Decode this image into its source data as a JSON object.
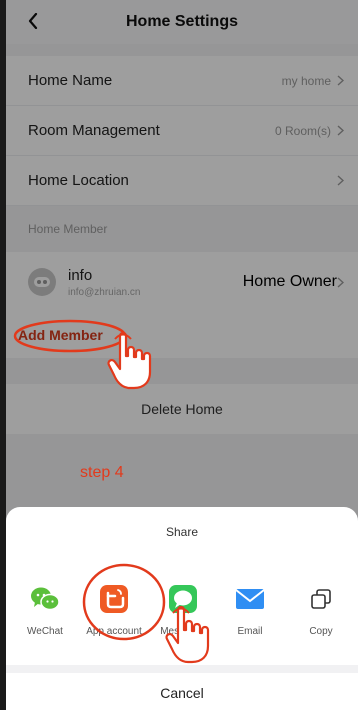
{
  "header": {
    "title": "Home Settings"
  },
  "settings": {
    "home_name": {
      "label": "Home Name",
      "value": "my home"
    },
    "room_management": {
      "label": "Room Management",
      "value": "0 Room(s)"
    },
    "home_location": {
      "label": "Home Location",
      "value": ""
    }
  },
  "member_section": {
    "label": "Home Member"
  },
  "member": {
    "name": "info",
    "email": "info@zhruian.cn",
    "role": "Home Owner"
  },
  "add_member": {
    "label": "Add Member"
  },
  "delete_home": {
    "label": "Delete Home"
  },
  "annotation": {
    "step": "step 4"
  },
  "share_sheet": {
    "title": "Share",
    "items": [
      {
        "label": "WeChat",
        "icon": "wechat-icon",
        "color": "#5bbf3b"
      },
      {
        "label": "App account",
        "icon": "tuya-app-icon",
        "color": "#ef5a24"
      },
      {
        "label": "Messages",
        "icon": "messages-icon",
        "color": "#35c759"
      },
      {
        "label": "Email",
        "icon": "email-icon",
        "color": "#2f8ef3"
      },
      {
        "label": "Copy",
        "icon": "copy-icon",
        "color": "#333333"
      }
    ],
    "cancel": "Cancel"
  },
  "colors": {
    "accent": "#d63b1d",
    "annotation": "#e23a1c"
  }
}
